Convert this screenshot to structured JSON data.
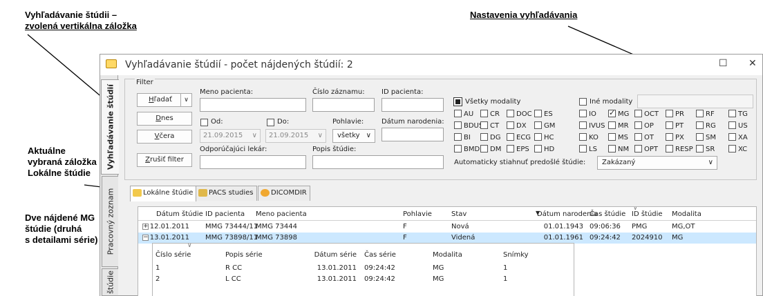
{
  "callouts": {
    "vertical_tab_line1": "Vyhľadávanie štúdii –",
    "vertical_tab_line2": "zvolená vertikálna záložka",
    "search_settings": "Nastavenia vyhľadávania",
    "current_tab_line1": "Aktuálne",
    "current_tab_line2": "vybraná záložka",
    "current_tab_line3": "Lokálne štúdie",
    "found_mg_line1": "Dve nájdené MG",
    "found_mg_line2": "štúdie (druhá",
    "found_mg_line3": "s detailami série)"
  },
  "window": {
    "title": "Vyhľadávanie štúdií - počet nájdených štúdií: 2",
    "maximize_glyph": "☐",
    "close_glyph": "✕"
  },
  "vertical_tabs": [
    {
      "label": "Vyhľadávanie štúdií"
    },
    {
      "label": "Pracovný zoznam"
    },
    {
      "label": "štúdie"
    }
  ],
  "filter": {
    "legend": "Filter",
    "search_button_prefix": "H",
    "search_button_rest": "ľadať",
    "search_button_arrow": "∨",
    "today_prefix": "D",
    "today_rest": "nes",
    "yesterday_prefix": "V",
    "yesterday_rest": "čera",
    "clear_prefix": "Z",
    "clear_rest": "rušiť filter",
    "patient_name_label": "Meno pacienta:",
    "record_number_label": "Číslo záznamu:",
    "patient_id_label": "ID pacienta:",
    "from_label": "Od:",
    "to_label": "Do:",
    "from_date": "21.09.2015",
    "to_date": "21.09.2015",
    "gender_label": "Pohlavie:",
    "gender_value": "všetky",
    "birth_date_label": "Dátum narodenia:",
    "referring_doctor_label": "Odporúčajúci lekár:",
    "study_desc_label": "Popis štúdie:",
    "all_modalities_label": "Všetky modality",
    "other_modalities_label": "Iné modality",
    "auto_download_label": "Automaticky stiahnuť predošlé štúdie:",
    "auto_download_value": "Zakázaný",
    "dropdown_arrow": "∨"
  },
  "modalities": [
    {
      "label": "AU",
      "checked": false
    },
    {
      "label": "CR",
      "checked": false
    },
    {
      "label": "DOC",
      "checked": false
    },
    {
      "label": "ES",
      "checked": false
    },
    {
      "label": "IO",
      "checked": false
    },
    {
      "label": "MG",
      "checked": true
    },
    {
      "label": "OCT",
      "checked": false
    },
    {
      "label": "PR",
      "checked": false
    },
    {
      "label": "RF",
      "checked": false
    },
    {
      "label": "TG",
      "checked": false
    },
    {
      "label": "BDUS",
      "checked": false
    },
    {
      "label": "CT",
      "checked": false
    },
    {
      "label": "DX",
      "checked": false
    },
    {
      "label": "GM",
      "checked": false
    },
    {
      "label": "IVUS",
      "checked": false
    },
    {
      "label": "MR",
      "checked": false
    },
    {
      "label": "OP",
      "checked": false
    },
    {
      "label": "PT",
      "checked": false
    },
    {
      "label": "RG",
      "checked": false
    },
    {
      "label": "US",
      "checked": false
    },
    {
      "label": "BI",
      "checked": false
    },
    {
      "label": "DG",
      "checked": false
    },
    {
      "label": "ECG",
      "checked": false
    },
    {
      "label": "HC",
      "checked": false
    },
    {
      "label": "KO",
      "checked": false
    },
    {
      "label": "MS",
      "checked": false
    },
    {
      "label": "OT",
      "checked": false
    },
    {
      "label": "PX",
      "checked": false
    },
    {
      "label": "SM",
      "checked": false
    },
    {
      "label": "XA",
      "checked": false
    },
    {
      "label": "BMD",
      "checked": false
    },
    {
      "label": "DM",
      "checked": false
    },
    {
      "label": "EPS",
      "checked": false
    },
    {
      "label": "HD",
      "checked": false
    },
    {
      "label": "LS",
      "checked": false
    },
    {
      "label": "NM",
      "checked": false
    },
    {
      "label": "OPT",
      "checked": false
    },
    {
      "label": "RESP",
      "checked": false
    },
    {
      "label": "SR",
      "checked": false
    },
    {
      "label": "XC",
      "checked": false
    }
  ],
  "sub_tabs": [
    {
      "label": "Lokálne štúdie",
      "color": "#f2c94c"
    },
    {
      "label": "PACS studies",
      "color": "#e0b84a"
    },
    {
      "label": "DICOMDIR",
      "color": "#f0a830"
    }
  ],
  "studies": {
    "headers": [
      "Dátum štúdie",
      "ID pacienta",
      "Meno pacienta",
      "Pohlavie",
      "Stav",
      "Dátum narodenia",
      "Čas štúdie",
      "ID štúdie",
      "Modalita"
    ],
    "sort_glyph": "▼",
    "expand_glyph": "+",
    "collapse_glyph": "−",
    "rows": [
      [
        "12.01.2011",
        "MMG 73444/11",
        "MMG 73444",
        "F",
        "Nová",
        "01.01.1943",
        "09:06:36",
        "PMG",
        "MG,OT"
      ],
      [
        "13.01.2011",
        "MMG 73898/11",
        "MMG 73898",
        "F",
        "Videná",
        "01.01.1961",
        "09:24:42",
        "2024910",
        "MG"
      ]
    ]
  },
  "series": {
    "headers": [
      "Číslo série",
      "Popis série",
      "Dátum série",
      "Čas série",
      "Modalita",
      "Snímky"
    ],
    "rows": [
      [
        "1",
        "R CC",
        "13.01.2011",
        "09:24:42",
        "MG",
        "1"
      ],
      [
        "2",
        "L CC",
        "13.01.2011",
        "09:24:42",
        "MG",
        "1"
      ]
    ]
  }
}
